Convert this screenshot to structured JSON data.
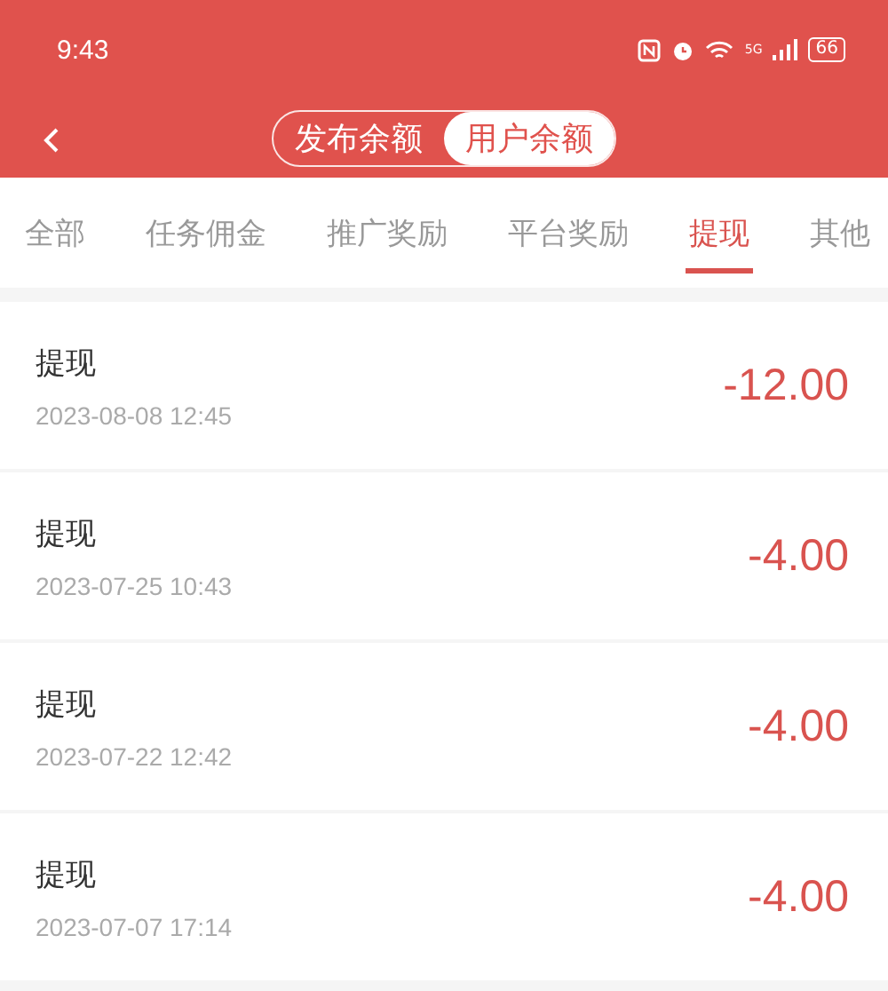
{
  "status_bar": {
    "time": "9:43",
    "network": "5G",
    "battery": "66"
  },
  "header": {
    "segments": [
      {
        "label": "发布余额",
        "selected": false
      },
      {
        "label": "用户余额",
        "selected": true
      }
    ]
  },
  "tabs": [
    {
      "label": "全部",
      "selected": false
    },
    {
      "label": "任务佣金",
      "selected": false
    },
    {
      "label": "推广奖励",
      "selected": false
    },
    {
      "label": "平台奖励",
      "selected": false
    },
    {
      "label": "提现",
      "selected": true
    },
    {
      "label": "其他",
      "selected": false
    }
  ],
  "records": [
    {
      "title": "提现",
      "time": "2023-08-08 12:45",
      "amount": "-12.00"
    },
    {
      "title": "提现",
      "time": "2023-07-25 10:43",
      "amount": "-4.00"
    },
    {
      "title": "提现",
      "time": "2023-07-22 12:42",
      "amount": "-4.00"
    },
    {
      "title": "提现",
      "time": "2023-07-07 17:14",
      "amount": "-4.00"
    }
  ]
}
